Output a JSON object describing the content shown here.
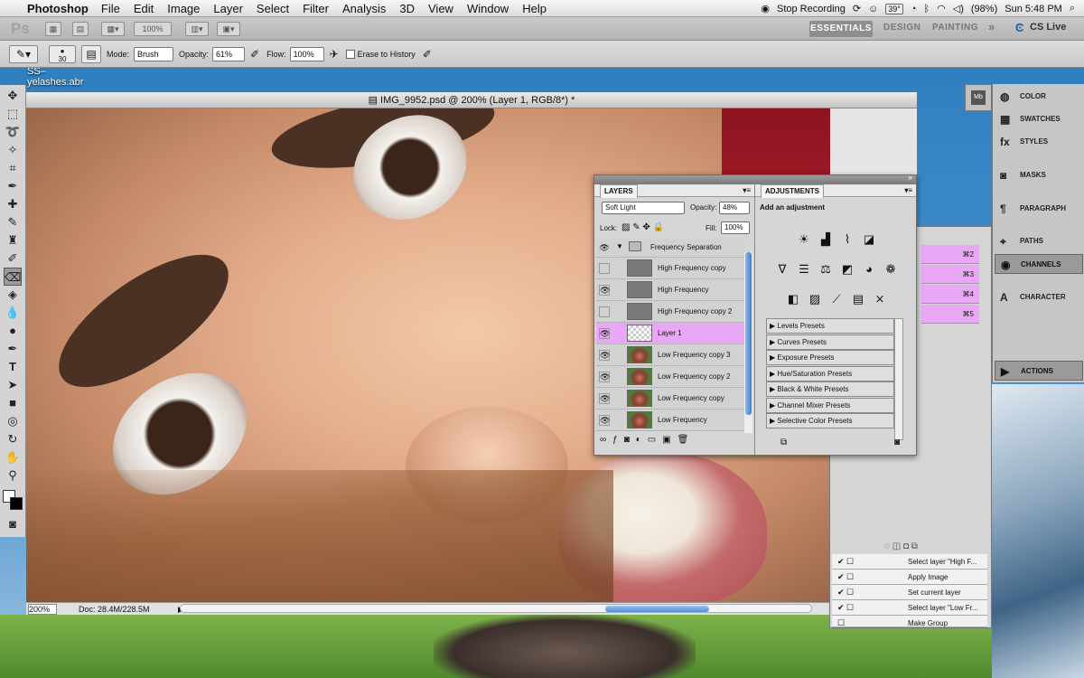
{
  "menubar": {
    "app_name": "Photoshop",
    "items": [
      "File",
      "Edit",
      "Image",
      "Layer",
      "Select",
      "Filter",
      "Analysis",
      "3D",
      "View",
      "Window",
      "Help"
    ],
    "status": {
      "recording": "Stop Recording",
      "temp": "39°",
      "battery": "(98%)",
      "clock": "Sun 5:48 PM"
    }
  },
  "appbar": {
    "logo": "Ps",
    "zoom": "100%",
    "workspaces": {
      "essentials": "ESSENTIALS",
      "design": "DESIGN",
      "painting": "PAINTING",
      "more": "»"
    },
    "cslive": "CS Live"
  },
  "options": {
    "brush_size": "30",
    "mode_label": "Mode:",
    "mode_value": "Brush",
    "opacity_label": "Opacity:",
    "opacity_value": "61%",
    "flow_label": "Flow:",
    "flow_value": "100%",
    "erase_history": "Erase to History"
  },
  "desktop": {
    "file_label": "SS–\nyelashes.abr"
  },
  "document": {
    "title": "IMG_9952.psd @ 200% (Layer 1, RGB/8*) *",
    "zoom": "200%",
    "doc_info": "Doc: 28.4M/228.5M"
  },
  "layers_panel": {
    "tab_layers": "LAYERS",
    "blend_mode": "Soft Light",
    "opacity_label": "Opacity:",
    "opacity_value": "48%",
    "lock_label": "Lock:",
    "fill_label": "Fill:",
    "fill_value": "100%",
    "group_name": "Frequency Separation",
    "layers": [
      {
        "name": "High Frequency copy",
        "visible": false,
        "thumb": "gray",
        "active": false
      },
      {
        "name": "High Frequency",
        "visible": true,
        "thumb": "gray",
        "active": false
      },
      {
        "name": "High Frequency copy 2",
        "visible": false,
        "thumb": "gray",
        "active": false
      },
      {
        "name": "Layer 1",
        "visible": true,
        "thumb": "trans",
        "active": true
      },
      {
        "name": "Low Frequency copy 3",
        "visible": true,
        "thumb": "photo",
        "active": false
      },
      {
        "name": "Low Frequency copy 2",
        "visible": true,
        "thumb": "photo",
        "active": false
      },
      {
        "name": "Low Frequency copy",
        "visible": true,
        "thumb": "photo",
        "active": false
      },
      {
        "name": "Low Frequency",
        "visible": true,
        "thumb": "photo",
        "active": false
      }
    ]
  },
  "adjustments_panel": {
    "tab": "ADJUSTMENTS",
    "heading": "Add an adjustment",
    "presets": [
      "Levels Presets",
      "Curves Presets",
      "Exposure Presets",
      "Hue/Saturation Presets",
      "Black & White Presets",
      "Channel Mixer Presets",
      "Selective Color Presets"
    ]
  },
  "right_panels": {
    "items": [
      "COLOR",
      "SWATCHES",
      "STYLES",
      "MASKS",
      "PARAGRAPH",
      "PATHS",
      "CHANNELS",
      "CHARACTER",
      "ACTIONS"
    ]
  },
  "channels_shortcuts": [
    "⌘2",
    "⌘3",
    "⌘4",
    "⌘5"
  ],
  "actions_steps": [
    "Select layer \"High F...",
    "Apply Image",
    "Set current layer",
    "Select layer \"Low Fr...",
    "Make Group"
  ],
  "colors": {
    "active_layer": "#e8a8f5",
    "scroll_accent": "#4f8fd8"
  }
}
